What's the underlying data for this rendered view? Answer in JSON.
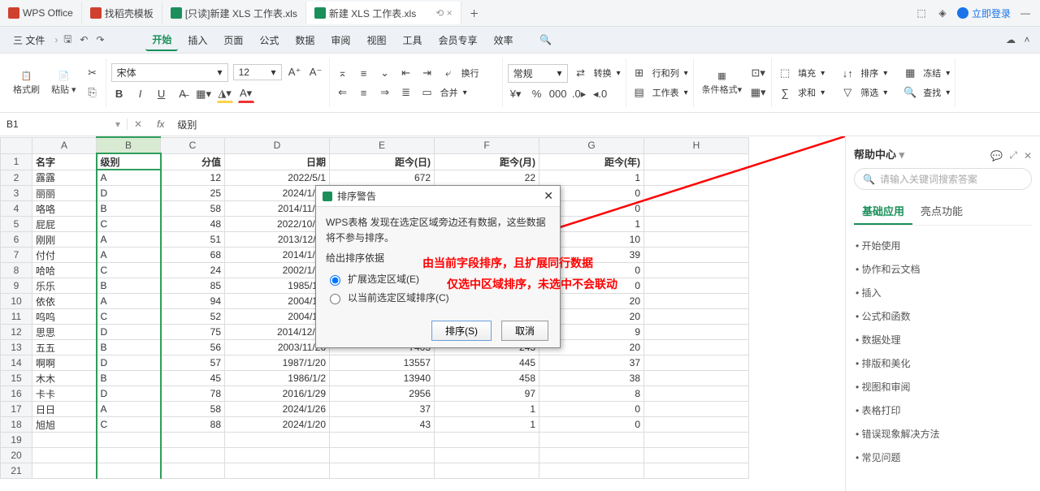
{
  "tabs": [
    {
      "icon": "#d0402f",
      "label": "WPS Office"
    },
    {
      "icon": "#d0402f",
      "label": "找稻壳模板"
    },
    {
      "icon": "#1a8f5a",
      "label": "[只读]新建 XLS 工作表.xls"
    },
    {
      "icon": "#1a8f5a",
      "label": "新建 XLS 工作表.xls",
      "active": true
    }
  ],
  "login": "立即登录",
  "menu": {
    "file": "三 文件",
    "items": [
      "开始",
      "插入",
      "页面",
      "公式",
      "数据",
      "审阅",
      "视图",
      "工具",
      "会员专享",
      "效率"
    ]
  },
  "ribbon": {
    "fmt": "格式刷",
    "paste": "粘贴",
    "font": "宋体",
    "size": "12",
    "wrap": "换行",
    "merge": "合并",
    "mode": "常规",
    "convert": "转换",
    "rowcol": "行和列",
    "sheet": "工作表",
    "cond": "条件格式",
    "fill": "填充",
    "sort": "排序",
    "freeze": "冻结",
    "sum": "求和",
    "filter": "筛选",
    "find": "查找"
  },
  "cellref": "B1",
  "fx": "级别",
  "cols": [
    "A",
    "B",
    "C",
    "D",
    "E",
    "F",
    "G",
    "H"
  ],
  "headers": [
    "名字",
    "级别",
    "分值",
    "日期",
    "距今(日)",
    "距今(月)",
    "距今(年)"
  ],
  "rows": [
    [
      "露露",
      "A",
      "12",
      "2022/5/1",
      "672",
      "22",
      "1"
    ],
    [
      "丽丽",
      "D",
      "25",
      "2024/1/14",
      "",
      "",
      "0"
    ],
    [
      "咯咯",
      "B",
      "58",
      "2014/11/21",
      "",
      "",
      "0"
    ],
    [
      "屁屁",
      "C",
      "48",
      "2022/10/20",
      "",
      "",
      "1"
    ],
    [
      "刚刚",
      "A",
      "51",
      "2013/12/11",
      "",
      "",
      "10"
    ],
    [
      "付付",
      "A",
      "68",
      "2014/1/13",
      "",
      "",
      "39"
    ],
    [
      "哈哈",
      "C",
      "24",
      "2002/1/21",
      "",
      "",
      "0"
    ],
    [
      "乐乐",
      "B",
      "85",
      "1985/1/6",
      "",
      "",
      "0"
    ],
    [
      "依依",
      "A",
      "94",
      "2004/1/2",
      "",
      "",
      "20"
    ],
    [
      "呜呜",
      "C",
      "52",
      "2004/1/2",
      "",
      "",
      "20"
    ],
    [
      "思思",
      "D",
      "75",
      "2014/12/24",
      "",
      "",
      "9"
    ],
    [
      "五五",
      "B",
      "56",
      "2003/11/26",
      "7403",
      "243",
      "20"
    ],
    [
      "啊啊",
      "D",
      "57",
      "1987/1/20",
      "13557",
      "445",
      "37"
    ],
    [
      "木木",
      "B",
      "45",
      "1986/1/2",
      "13940",
      "458",
      "38"
    ],
    [
      "卡卡",
      "D",
      "78",
      "2016/1/29",
      "2956",
      "97",
      "8"
    ],
    [
      "日日",
      "A",
      "58",
      "2024/1/26",
      "37",
      "1",
      "0"
    ],
    [
      "旭旭",
      "C",
      "88",
      "2024/1/20",
      "43",
      "1",
      "0"
    ]
  ],
  "dialog": {
    "title": "排序警告",
    "text": "WPS表格 发现在选定区域旁边还有数据，这些数据将不参与排序。",
    "group": "给出排序依据",
    "opt1": "扩展选定区域(E)",
    "opt2": "以当前选定区域排序(C)",
    "ok": "排序(S)",
    "cancel": "取消"
  },
  "annot1": "由当前字段排序，且扩展同行数据",
  "annot2": "仅选中区域排序，未选中不会联动",
  "help": {
    "title": "帮助中心",
    "ph": "请输入关键词搜索答案",
    "tabs": [
      "基础应用",
      "亮点功能"
    ],
    "items": [
      "开始使用",
      "协作和云文档",
      "插入",
      "公式和函数",
      "数据处理",
      "排版和美化",
      "视图和审阅",
      "表格打印",
      "错误现象解决方法",
      "常见问题"
    ]
  }
}
